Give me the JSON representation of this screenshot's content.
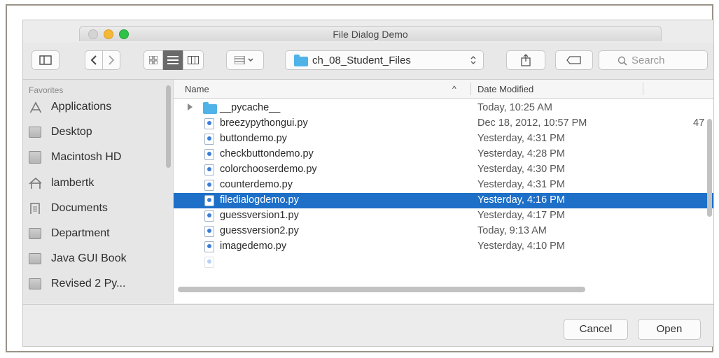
{
  "window": {
    "title": "File Dialog Demo"
  },
  "toolbar": {
    "current_folder": "ch_08_Student_Files",
    "search_placeholder": "Search"
  },
  "sidebar": {
    "heading": "Favorites",
    "items": [
      {
        "label": "Applications",
        "icon": "applications-icon"
      },
      {
        "label": "Desktop",
        "icon": "desktop-icon"
      },
      {
        "label": "Macintosh HD",
        "icon": "disk-icon"
      },
      {
        "label": "lambertk",
        "icon": "home-icon"
      },
      {
        "label": "Documents",
        "icon": "documents-icon"
      },
      {
        "label": "Department",
        "icon": "folder-icon"
      },
      {
        "label": "Java GUI Book",
        "icon": "folder-icon"
      },
      {
        "label": "Revised 2 Py...",
        "icon": "folder-icon"
      }
    ]
  },
  "columns": {
    "name": "Name",
    "sort_indicator": "^",
    "date": "Date Modified"
  },
  "files": [
    {
      "name": "__pycache__",
      "date": "Today, 10:25 AM",
      "size": "",
      "type": "folder",
      "selected": false
    },
    {
      "name": "breezypythongui.py",
      "date": "Dec 18, 2012, 10:57 PM",
      "size": "47",
      "type": "file",
      "selected": false
    },
    {
      "name": "buttondemo.py",
      "date": "Yesterday, 4:31 PM",
      "size": "",
      "type": "file",
      "selected": false
    },
    {
      "name": "checkbuttondemo.py",
      "date": "Yesterday, 4:28 PM",
      "size": "",
      "type": "file",
      "selected": false
    },
    {
      "name": "colorchooserdemo.py",
      "date": "Yesterday, 4:30 PM",
      "size": "",
      "type": "file",
      "selected": false
    },
    {
      "name": "counterdemo.py",
      "date": "Yesterday, 4:31 PM",
      "size": "",
      "type": "file",
      "selected": false
    },
    {
      "name": "filedialogdemo.py",
      "date": "Yesterday, 4:16 PM",
      "size": "",
      "type": "file",
      "selected": true
    },
    {
      "name": "guessversion1.py",
      "date": "Yesterday, 4:17 PM",
      "size": "",
      "type": "file",
      "selected": false
    },
    {
      "name": "guessversion2.py",
      "date": "Today, 9:13 AM",
      "size": "",
      "type": "file",
      "selected": false
    },
    {
      "name": "imagedemo.py",
      "date": "Yesterday, 4:10 PM",
      "size": "",
      "type": "file",
      "selected": false
    }
  ],
  "footer": {
    "cancel_label": "Cancel",
    "open_label": "Open"
  },
  "colors": {
    "selection": "#1d6fc8",
    "folder": "#4fb3e8",
    "close": "#d0d0d0",
    "minimize": "#f5b736",
    "zoom": "#2fc248"
  }
}
